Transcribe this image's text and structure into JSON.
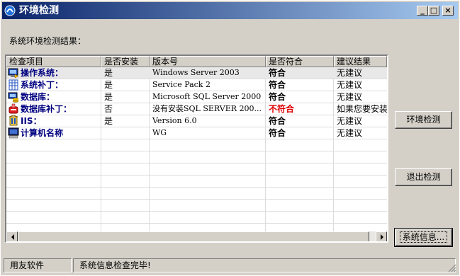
{
  "window": {
    "title": "环境检测",
    "minimize": "_",
    "maximize": "□",
    "close": "×"
  },
  "result_label": "系统环境检测结果：",
  "columns": [
    "检查项目",
    "是否安装",
    "版本号",
    "是否符合",
    "建议结果"
  ],
  "rows": [
    {
      "icon": "os-icon",
      "name": "操作系统：",
      "installed": "是",
      "version": "Windows Server 2003",
      "match": "符合",
      "advice": "无建议"
    },
    {
      "icon": "patch-icon",
      "name": "系统补丁：",
      "installed": "是",
      "version": "Service Pack 2",
      "match": "符合",
      "advice": "无建议"
    },
    {
      "icon": "database-icon",
      "name": "数据库：",
      "installed": "是",
      "version": "Microsoft SQL Server 2000",
      "match": "符合",
      "advice": "无建议"
    },
    {
      "icon": "db-patch-warning-icon",
      "name": "数据库补丁：",
      "installed": "否",
      "version": "没有安装SQL SERVER 200...",
      "match": "不符合",
      "advice": "如果您要安装"
    },
    {
      "icon": "iis-icon",
      "name": "IIS：",
      "installed": "是",
      "version": "Version 6.0",
      "match": "符合",
      "advice": "无建议"
    },
    {
      "icon": "computer-icon",
      "name": "计算机名称",
      "installed": "",
      "version": "WG",
      "match": "符合",
      "advice": "无建议"
    }
  ],
  "buttons": {
    "check": "环境检测",
    "exit": "退出检测",
    "sysinfo": "系统信息..."
  },
  "status": {
    "company": "用友软件",
    "message": "系统信息检查完毕!"
  },
  "colors": {
    "titlebar_start": "#0a246a",
    "titlebar_end": "#a6caf0",
    "fail": "#e00000",
    "item_name": "#000080"
  }
}
